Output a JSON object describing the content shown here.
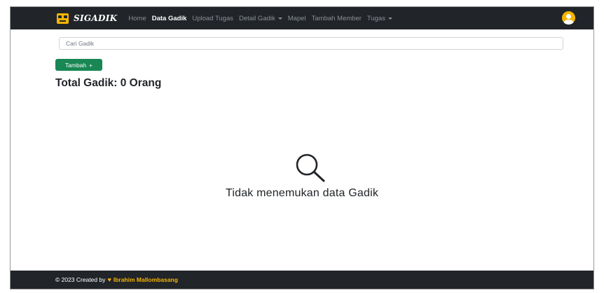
{
  "navbar": {
    "brand": "SIGADIK",
    "items": [
      {
        "label": "Home",
        "active": false,
        "dropdown": false
      },
      {
        "label": "Data Gadik",
        "active": true,
        "dropdown": false
      },
      {
        "label": "Upload Tugas",
        "active": false,
        "dropdown": false
      },
      {
        "label": "Detail Gadik",
        "active": false,
        "dropdown": true
      },
      {
        "label": "Mapel",
        "active": false,
        "dropdown": false
      },
      {
        "label": "Tambah Member",
        "active": false,
        "dropdown": false
      },
      {
        "label": "Tugas",
        "active": false,
        "dropdown": true
      }
    ]
  },
  "search": {
    "placeholder": "Cari Gadik"
  },
  "add_button": {
    "label": "Tambah",
    "icon": "+"
  },
  "total": "Total Gadik: 0 Orang",
  "empty_state": {
    "icon": "search-icon",
    "text": "Tidak menemukan data Gadik"
  },
  "footer": {
    "prefix": "© 2023 Created by",
    "icon": "♥",
    "author": "Ibrahim Mallombasang"
  },
  "colors": {
    "navbar": "#212529",
    "accent": "#f5b400",
    "success": "#198754"
  }
}
